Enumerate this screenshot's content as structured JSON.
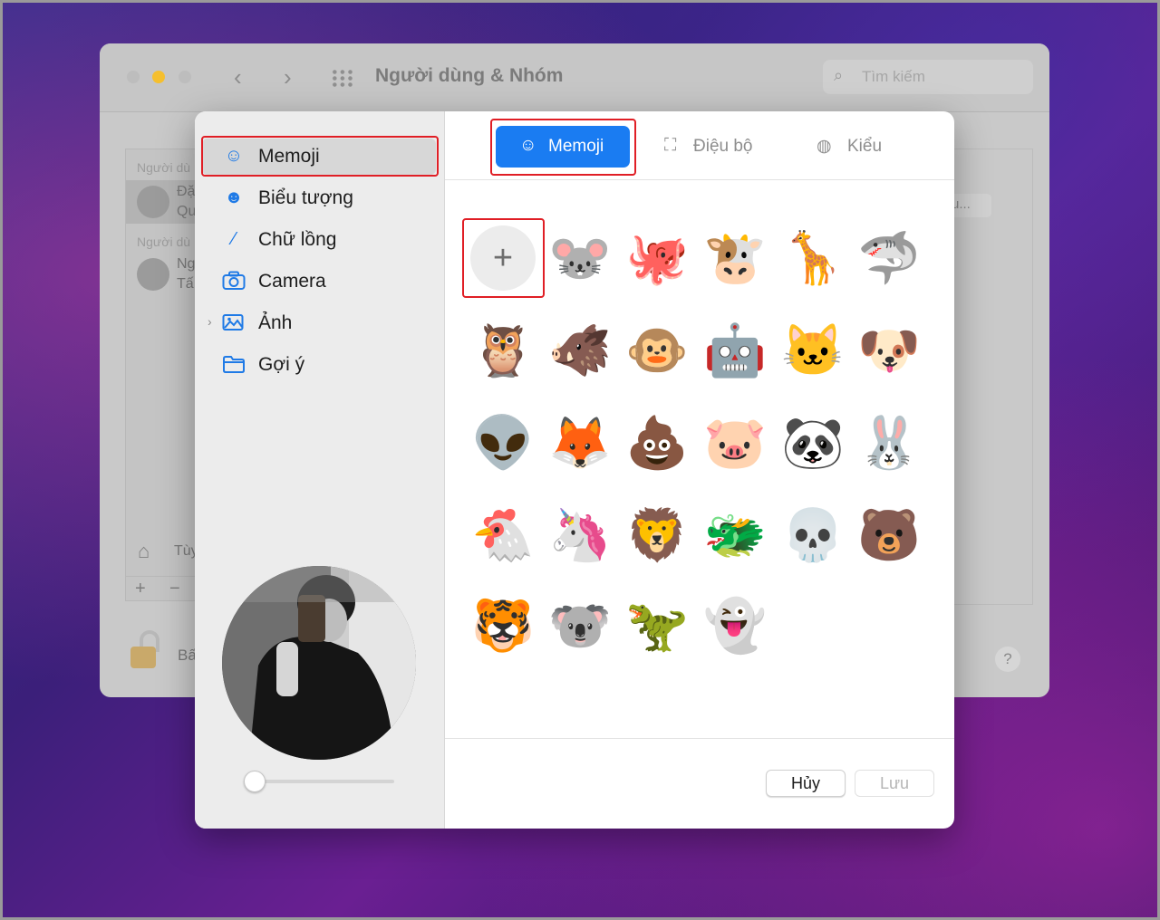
{
  "background_window": {
    "title": "Người dùng & Nhóm",
    "search_placeholder": "Tìm kiếm",
    "list_header_1": "Người dù",
    "user_1_name": "Đặ",
    "user_1_sub": "Qu",
    "list_header_2": "Người dù",
    "user_2_name": "Ng",
    "user_2_sub": "Tấ",
    "login_options": "Tùy",
    "lock_text": "Bấ",
    "detail_button": "u...",
    "help": "?"
  },
  "sidebar": {
    "items": [
      {
        "label": "Memoji",
        "icon": "memoji-icon"
      },
      {
        "label": "Biểu tượng",
        "icon": "smiley-icon"
      },
      {
        "label": "Chữ lồng",
        "icon": "pencil-icon"
      },
      {
        "label": "Camera",
        "icon": "camera-icon"
      },
      {
        "label": "Ảnh",
        "icon": "photos-icon"
      },
      {
        "label": "Gợi ý",
        "icon": "folder-icon"
      }
    ],
    "selected": "Memoji"
  },
  "tabs": [
    {
      "label": "Memoji",
      "icon": "memoji-icon",
      "active": true
    },
    {
      "label": "Điệu bộ",
      "icon": "pose-icon",
      "active": false
    },
    {
      "label": "Kiểu",
      "icon": "palette-icon",
      "active": false
    }
  ],
  "memoji_grid": {
    "add_button": "+",
    "items": [
      "🐭",
      "🐙",
      "🐮",
      "🦒",
      "🦈",
      "🦉",
      "🐗",
      "🐵",
      "🤖",
      "🐱",
      "🐶",
      "👽",
      "🦊",
      "💩",
      "🐷",
      "🐼",
      "🐰",
      "🐔",
      "🦄",
      "🦁",
      "🐲",
      "💀",
      "🐻",
      "🐯",
      "🐨",
      "🦖",
      "👻"
    ]
  },
  "buttons": {
    "cancel": "Hủy",
    "save": "Lưu"
  },
  "colors": {
    "accent": "#1a7cf2",
    "highlight_box": "#e01e25"
  }
}
